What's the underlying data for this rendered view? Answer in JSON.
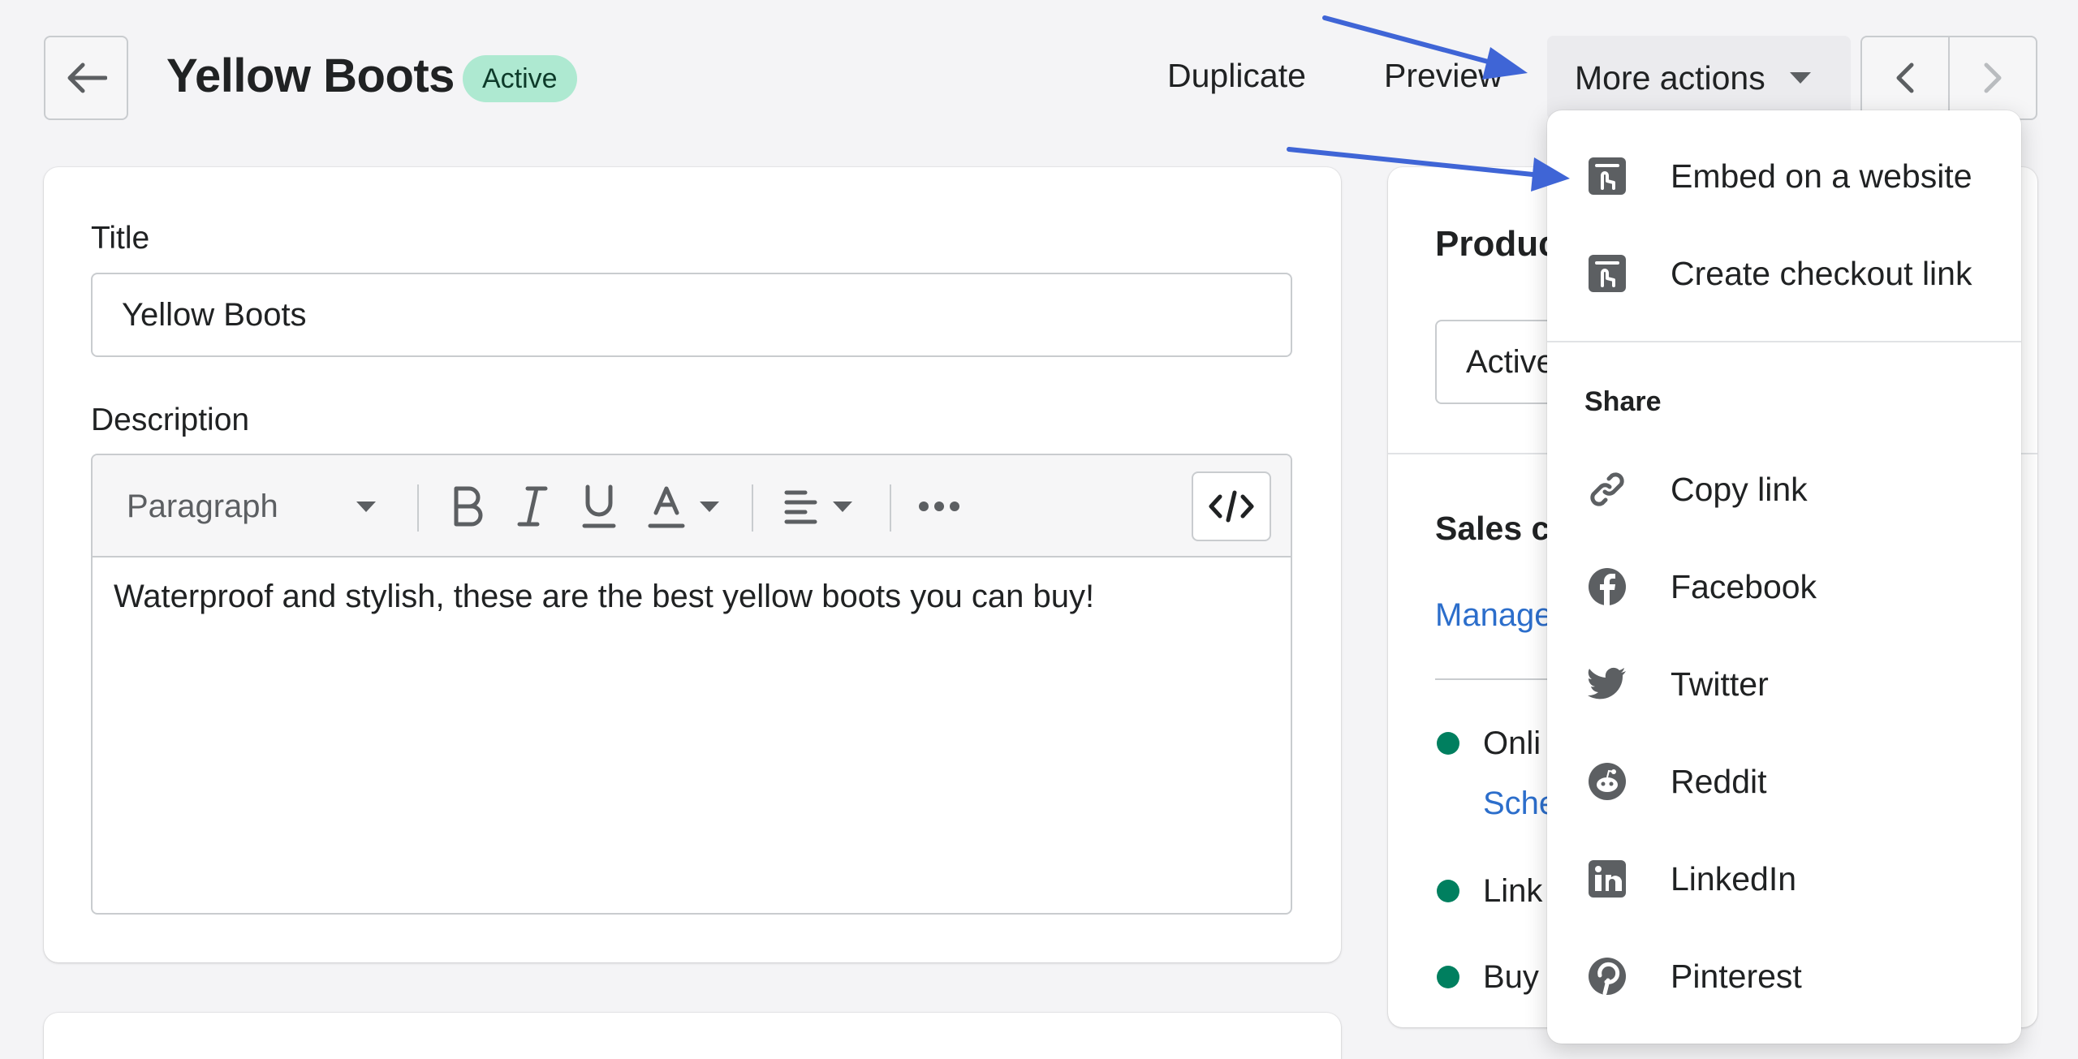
{
  "header": {
    "title": "Yellow Boots",
    "status_badge": "Active",
    "actions": [
      "Duplicate",
      "Preview"
    ],
    "more_actions_label": "More actions"
  },
  "product_form": {
    "title_label": "Title",
    "title_value": "Yellow Boots",
    "description_label": "Description",
    "toolbar": {
      "paragraph_select": "Paragraph",
      "bold": "B",
      "italic": "I",
      "underline": "U",
      "text_color": "A"
    },
    "description_text": "Waterproof and stylish, these are the best yellow boots you can buy!"
  },
  "side_panel": {
    "product_status_title": "Produc",
    "status_value": "Active",
    "sales_channels_title": "Sales c",
    "manage_link": "Manage",
    "channels": [
      {
        "label": "Onli",
        "sub_link": "Sche"
      },
      {
        "label": "Link"
      },
      {
        "label": "Buy"
      }
    ]
  },
  "more_actions_menu": {
    "items": [
      {
        "label": "Embed on a website",
        "icon": "embed-icon"
      },
      {
        "label": "Create checkout link",
        "icon": "checkout-link-icon"
      }
    ],
    "share_heading": "Share",
    "share_items": [
      {
        "label": "Copy link",
        "icon": "link-icon"
      },
      {
        "label": "Facebook",
        "icon": "facebook-icon"
      },
      {
        "label": "Twitter",
        "icon": "twitter-icon"
      },
      {
        "label": "Reddit",
        "icon": "reddit-icon"
      },
      {
        "label": "LinkedIn",
        "icon": "linkedin-icon"
      },
      {
        "label": "Pinterest",
        "icon": "pinterest-icon"
      }
    ]
  },
  "colors": {
    "annotation_arrow": "#3f65d6",
    "badge_bg": "#aee9d1",
    "link": "#2c6ecb",
    "status_dot": "#007f5f"
  }
}
